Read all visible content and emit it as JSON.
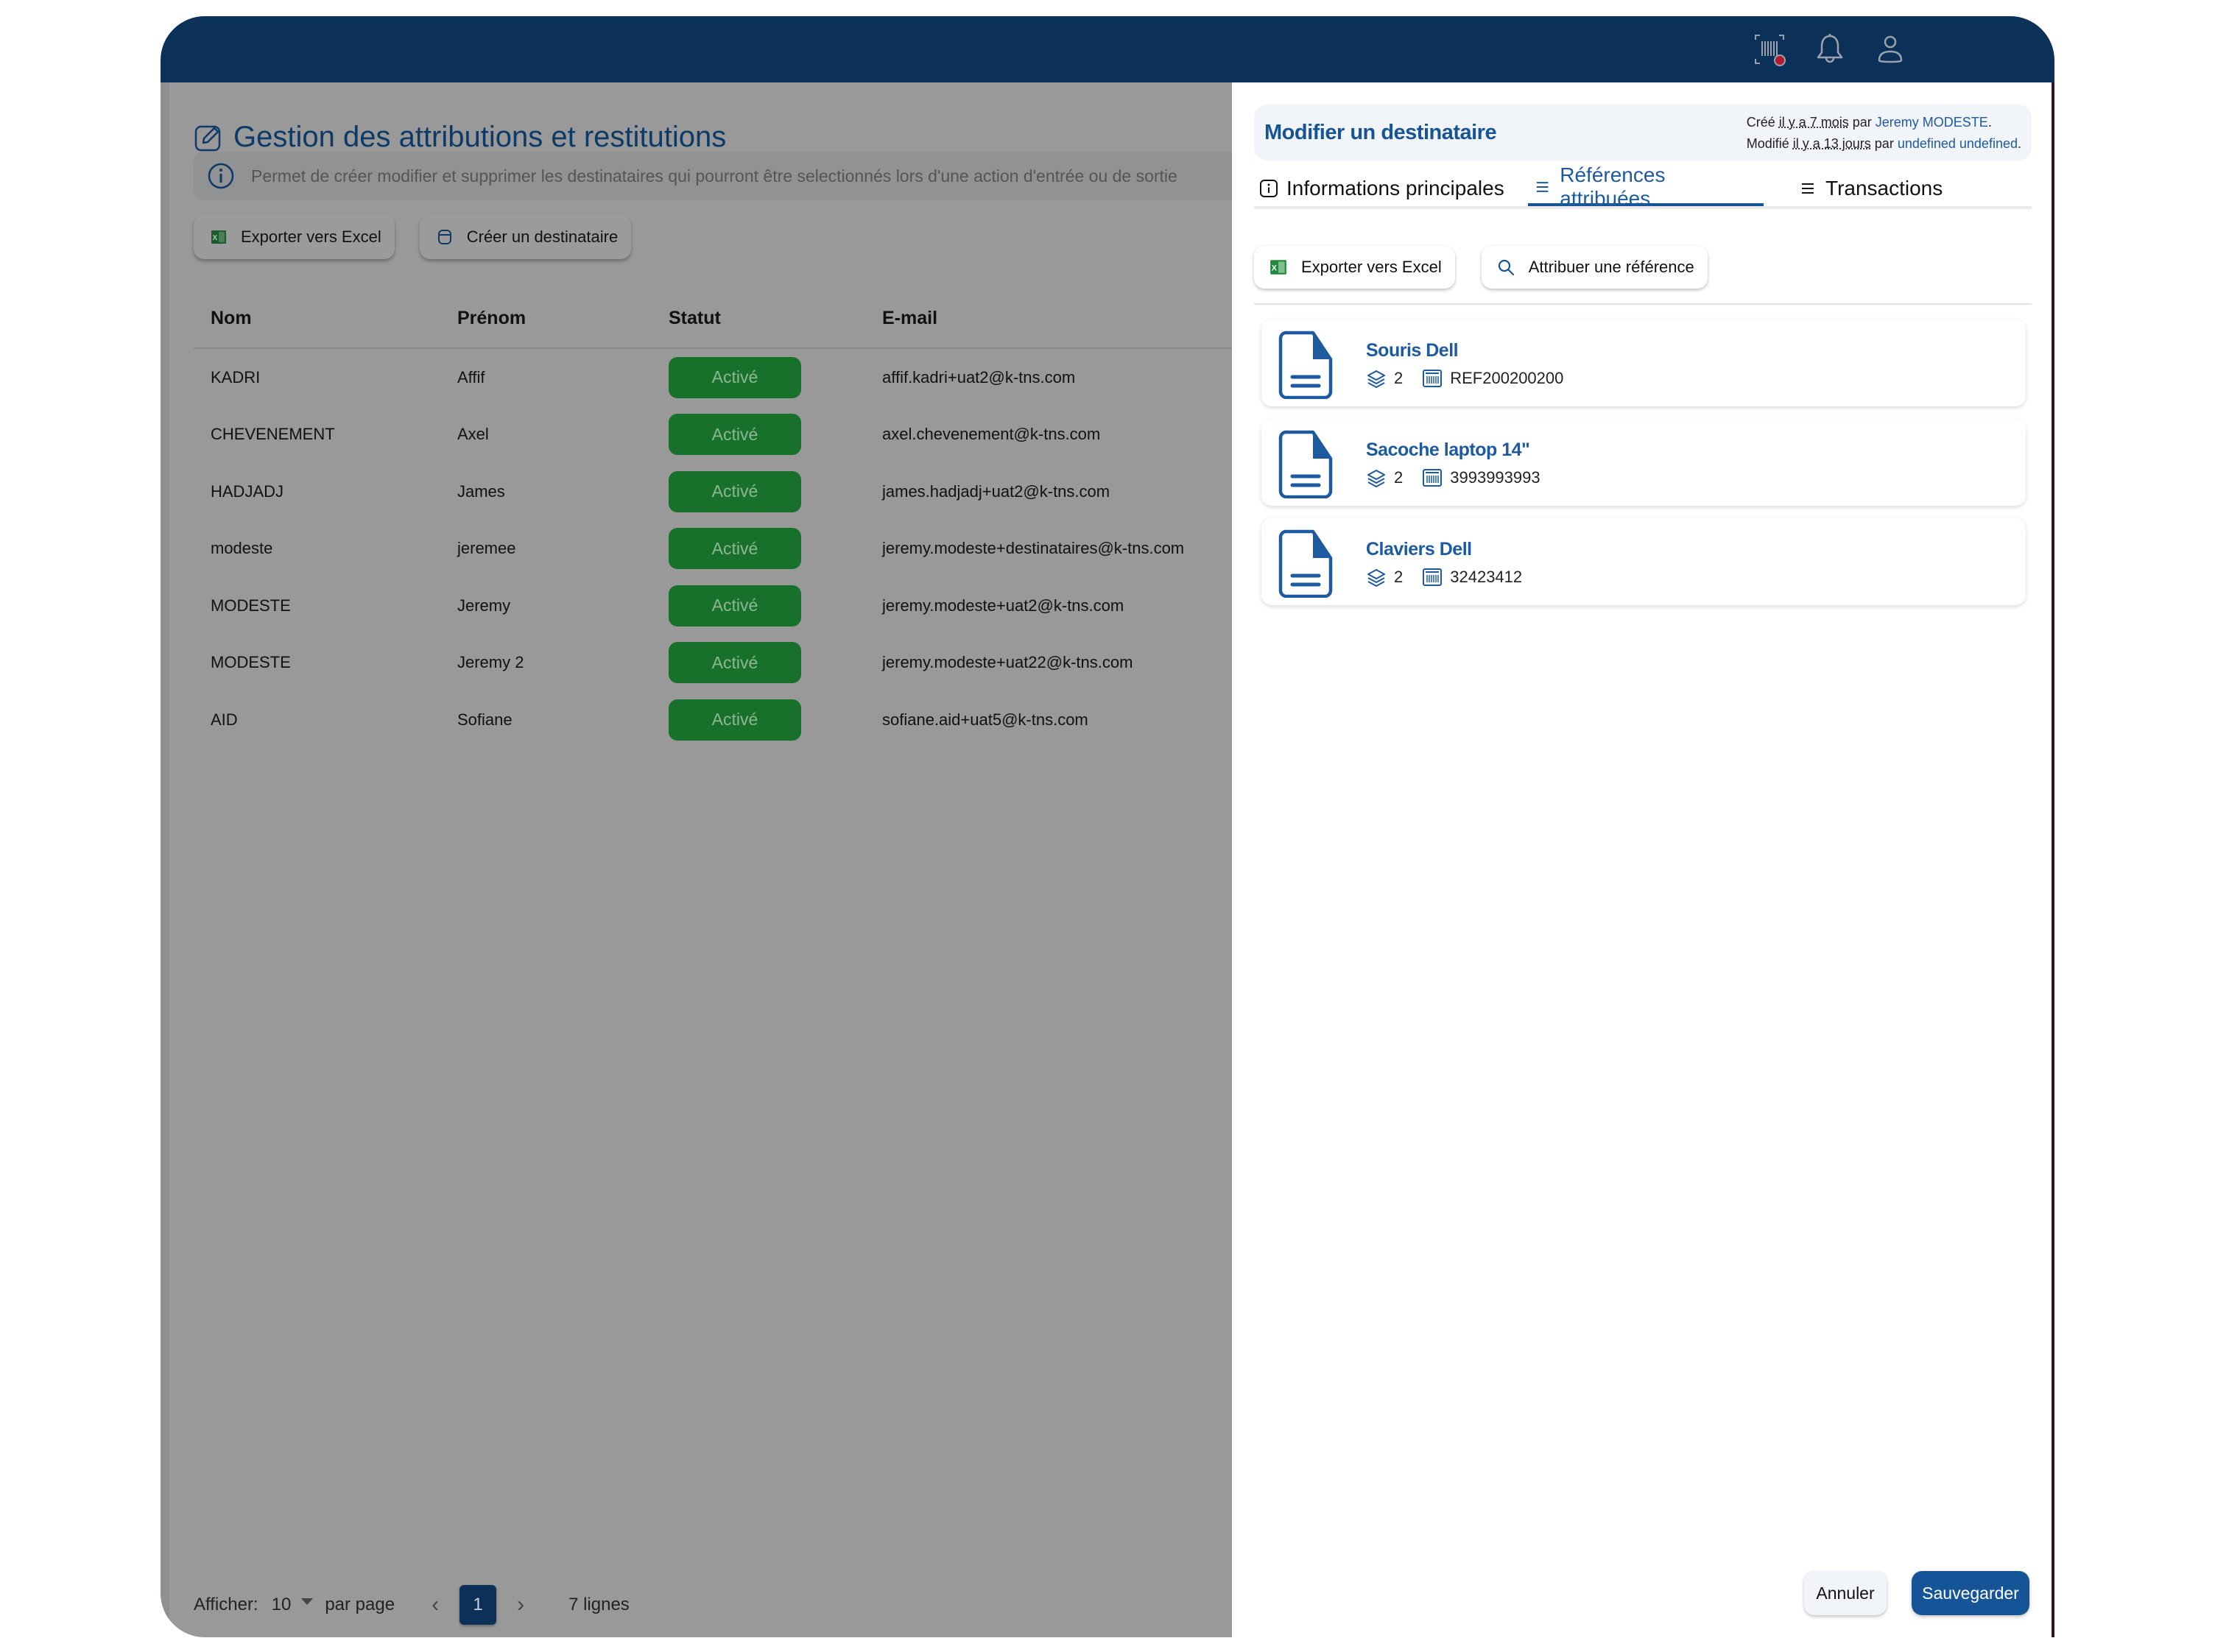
{
  "topbar": {
    "icons": [
      "barcode-scan-icon",
      "bell-icon",
      "user-icon"
    ],
    "notification_dot_color": "#b01c2e",
    "background_color": "#0c3158"
  },
  "page": {
    "title": "Gestion des attributions et restitutions",
    "info_text": "Permet de créer modifier et supprimer les destinataires qui pourront être selectionnés lors d'une action d'entrée ou de sortie",
    "buttons": {
      "export": "Exporter vers Excel",
      "create": "Créer un destinataire"
    },
    "table": {
      "columns": [
        "Nom",
        "Prénom",
        "Statut",
        "E-mail"
      ],
      "rows": [
        {
          "nom": "KADRI",
          "prenom": "Affif",
          "statut": "Activé",
          "email": "affif.kadri+uat2@k-tns.com"
        },
        {
          "nom": "CHEVENEMENT",
          "prenom": "Axel",
          "statut": "Activé",
          "email": "axel.chevenement@k-tns.com"
        },
        {
          "nom": "HADJADJ",
          "prenom": "James",
          "statut": "Activé",
          "email": "james.hadjadj+uat2@k-tns.com"
        },
        {
          "nom": "modeste",
          "prenom": "jeremee",
          "statut": "Activé",
          "email": "jeremy.modeste+destinataires@k-tns.com"
        },
        {
          "nom": "MODESTE",
          "prenom": "Jeremy",
          "statut": "Activé",
          "email": "jeremy.modeste+uat2@k-tns.com"
        },
        {
          "nom": "MODESTE",
          "prenom": "Jeremy 2",
          "statut": "Activé",
          "email": "jeremy.modeste+uat22@k-tns.com"
        },
        {
          "nom": "AID",
          "prenom": "Sofiane",
          "statut": "Activé",
          "email": "sofiane.aid+uat5@k-tns.com"
        }
      ]
    },
    "pagination": {
      "show_label": "Afficher:",
      "page_size": "10",
      "per_page_label": "par page",
      "current_page": "1",
      "prev": "‹",
      "next": "›",
      "total_label": "7 lignes"
    }
  },
  "drawer": {
    "title": "Modifier un destinataire",
    "created": {
      "prefix": "Créé ",
      "when": "il y a 7 mois",
      "by": " par ",
      "author": "Jeremy MODESTE",
      "suffix": "."
    },
    "modified": {
      "prefix": "Modifié ",
      "when": "il y a 13 jours",
      "by": " par ",
      "author": "undefined undefined",
      "suffix": "."
    },
    "tabs": [
      {
        "label": "Informations principales",
        "icon": "info-icon",
        "active": false
      },
      {
        "label": "Références attribuées",
        "icon": "list-icon",
        "active": true
      },
      {
        "label": "Transactions",
        "icon": "list-icon",
        "active": false
      }
    ],
    "buttons": {
      "export": "Exporter vers Excel",
      "assign": "Attribuer une référence"
    },
    "references": [
      {
        "name": "Souris Dell",
        "quantity": "2",
        "reference": "REF200200200"
      },
      {
        "name": "Sacoche laptop 14\"",
        "quantity": "2",
        "reference": "3993993993"
      },
      {
        "name": "Claviers Dell",
        "quantity": "2",
        "reference": "32423412"
      }
    ],
    "footer": {
      "cancel": "Annuler",
      "save": "Sauvegarder"
    }
  },
  "colors": {
    "brand_navy": "#0c3158",
    "accent_blue": "#175496",
    "status_active": "#18712a",
    "overlay_gray": "#999999"
  }
}
